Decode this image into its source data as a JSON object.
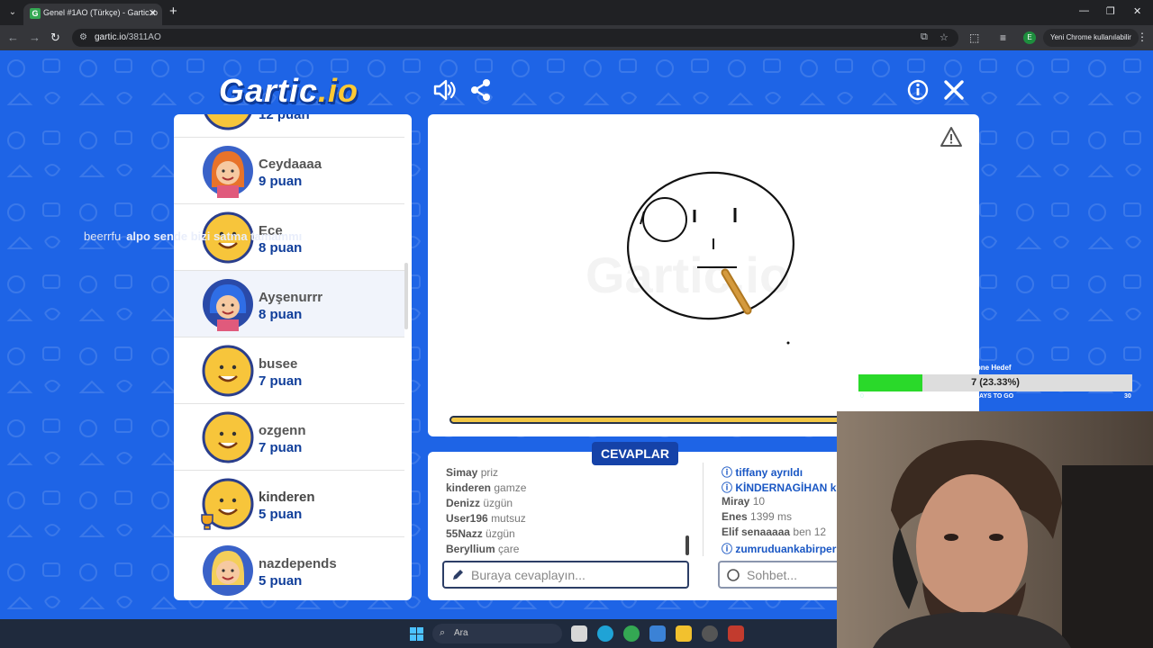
{
  "browser": {
    "tab_title": "Genel #1AO (Türkçe) - Gartic.io",
    "url_host": "gartic.io",
    "url_path": "/3811AO",
    "profile_initial": "E",
    "update_label": "Yeni Chrome kullanılabilir"
  },
  "app": {
    "logo_main": "Gartic",
    "logo_accent": ".io"
  },
  "players": [
    {
      "name": "",
      "points": "12 puan",
      "avatar": "yellow"
    },
    {
      "name": "Ceydaaaa",
      "points": "9 puan",
      "avatar": "orange-hair"
    },
    {
      "name": "Ece",
      "points": "8 puan",
      "avatar": "yellow"
    },
    {
      "name": "Ayşenurrr",
      "points": "8 puan",
      "avatar": "blue-hair"
    },
    {
      "name": "busee",
      "points": "7 puan",
      "avatar": "yellow"
    },
    {
      "name": "ozgenn",
      "points": "7 puan",
      "avatar": "yellow"
    },
    {
      "name": "kinderen",
      "points": "5 puan",
      "avatar": "yellow-trophy"
    },
    {
      "name": "nazdepends",
      "points": "5 puan",
      "avatar": "blonde-hair"
    }
  ],
  "overlay_chat": {
    "user": "beerrfu",
    "message": "alpo sende bizi satma tamammı"
  },
  "answers": {
    "tab_label": "CEVAPLAR",
    "items": [
      {
        "user": "Simay",
        "text": "priz"
      },
      {
        "user": "kinderen",
        "text": "gamze"
      },
      {
        "user": "Denizz",
        "text": "üzgün"
      },
      {
        "user": "User196",
        "text": "mutsuz"
      },
      {
        "user": "55Nazz",
        "text": "üzgün"
      },
      {
        "user": "Beryllium",
        "text": "çare"
      }
    ],
    "input_placeholder": "Buraya cevaplayın..."
  },
  "chat": {
    "items": [
      {
        "user": "tiffany",
        "text": "ayrıldı",
        "system": true
      },
      {
        "user": "KİNDERNAGİHAN",
        "text": "k",
        "system": true
      },
      {
        "user": "Miray",
        "text": "10",
        "system": false
      },
      {
        "user": "Enes",
        "text": "1399 ms",
        "system": false
      },
      {
        "user": "Elif senaaaaa",
        "text": "ben 12",
        "system": false
      },
      {
        "user": "zumruduankabirperi",
        "text": "",
        "system": true
      }
    ],
    "input_placeholder": "Sohbet..."
  },
  "stream_goal": {
    "label": "bone Hedef",
    "text": "7 (23.33%)",
    "fraction": 0.2333,
    "min": "0",
    "days": "DAYS TO GO",
    "max": "30"
  },
  "taskbar": {
    "search_label": "Ara"
  },
  "colors": {
    "page_bg": "#1e64e6",
    "points": "#103e9a",
    "answers_tag": "#1542a8",
    "timer": "#f2c744",
    "goal_fill": "#2ad92a"
  },
  "icons": {
    "sound": "speaker-icon",
    "share": "share-icon",
    "info": "info-icon",
    "close": "close-icon",
    "report": "warning-icon"
  }
}
